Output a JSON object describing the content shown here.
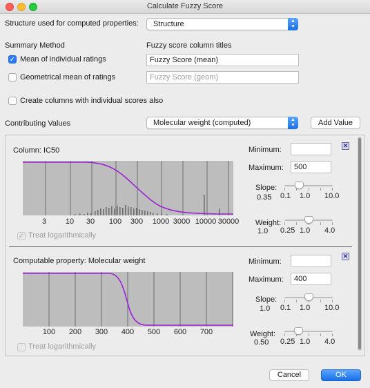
{
  "window": {
    "title": "Calculate Fuzzy Score"
  },
  "structure": {
    "label": "Structure used for computed properties:",
    "value": "Structure"
  },
  "summary": {
    "heading": "Summary Method",
    "mean_label": "Mean of individual ratings",
    "geom_label": "Geometrical mean of ratings",
    "mean_checked": true,
    "geom_checked": false
  },
  "titles": {
    "heading": "Fuzzy score column titles",
    "mean_value": "Fuzzy Score (mean)",
    "geom_placeholder": "Fuzzy Score (geom)"
  },
  "individual": {
    "label": "Create columns with individual scores also",
    "checked": false
  },
  "contributing": {
    "label": "Contributing Values",
    "selected": "Molecular weight (computed)",
    "add_button": "Add Value"
  },
  "panels": [
    {
      "title": "Column: IC50",
      "minimum_label": "Minimum:",
      "minimum": "",
      "maximum_label": "Maximum:",
      "maximum": "500",
      "slope_label": "Slope:",
      "slope_value": "0.35",
      "slope_ticks": [
        "0.1",
        "1.0",
        "10.0"
      ],
      "slope_pos": 0.27,
      "weight_label": "Weight:",
      "weight_value": "1.0",
      "weight_ticks": [
        "0.25",
        "1.0",
        "4.0"
      ],
      "weight_pos": 0.5,
      "log_label": "Treat logarithmically",
      "log_checked": true,
      "axis_ticks": [
        "3",
        "10",
        "30",
        "100",
        "300",
        "1000",
        "3000",
        "10000",
        "30000"
      ],
      "close_icon": "close-icon"
    },
    {
      "title": "Computable property: Molecular weight",
      "minimum_label": "Minimum:",
      "minimum": "",
      "maximum_label": "Maximum:",
      "maximum": "400",
      "slope_label": "Slope:",
      "slope_value": "1.0",
      "slope_ticks": [
        "0.1",
        "1.0",
        "10.0"
      ],
      "slope_pos": 0.5,
      "weight_label": "Weight:",
      "weight_value": "0.50",
      "weight_ticks": [
        "0.25",
        "1.0",
        "4.0"
      ],
      "weight_pos": 0.25,
      "log_label": "Treat logarithmically",
      "log_checked": false,
      "axis_ticks": [
        "100",
        "200",
        "300",
        "400",
        "500",
        "600",
        "700"
      ],
      "close_icon": "close-icon"
    }
  ],
  "buttons": {
    "cancel": "Cancel",
    "ok": "OK"
  },
  "colors": {
    "curve": "#9b1fd6",
    "accent": "#2b7bf2",
    "chart_bg": "#bdbdbd"
  }
}
